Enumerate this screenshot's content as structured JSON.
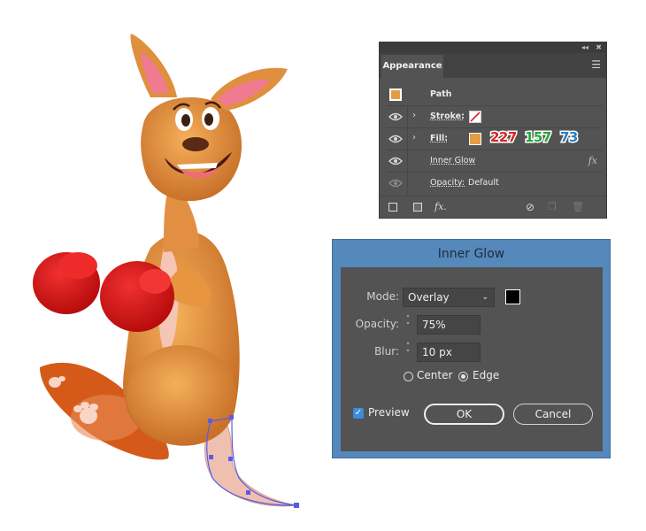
{
  "appearance_panel": {
    "tab_label": "Appearance",
    "collapse_icon": "double-chevron-left-icon",
    "close_icon": "close-icon",
    "menu_icon": "hamburger-menu-icon",
    "object_label": "Path",
    "stroke_label": "Stroke:",
    "fill_label": "Fill:",
    "effect_label": "Inner Glow",
    "effect_fx": "fx",
    "opacity_label": "Opacity:",
    "opacity_value": "Default",
    "fill_color": "#e39d49",
    "fill_rgb": {
      "r": "227",
      "g": "157",
      "b": "73"
    },
    "rgb_colors": {
      "r": "#e02020",
      "g": "#22a636",
      "b": "#2a7fc4"
    },
    "bottom_fx": "fx."
  },
  "inner_glow_dialog": {
    "title": "Inner Glow",
    "mode_label": "Mode:",
    "mode_value": "Overlay",
    "glow_color": "#000000",
    "opacity_label": "Opacity:",
    "opacity_value": "75%",
    "blur_label": "Blur:",
    "blur_value": "10 px",
    "center_label": "Center",
    "edge_label": "Edge",
    "selected_option": "Edge",
    "preview_label": "Preview",
    "preview_checked": true,
    "ok_label": "OK",
    "cancel_label": "Cancel",
    "title_bar_color": "#5588bb"
  },
  "artwork": {
    "subject": "kangaroo-with-boxing-gloves",
    "selection_color": "#5a5ae6"
  }
}
